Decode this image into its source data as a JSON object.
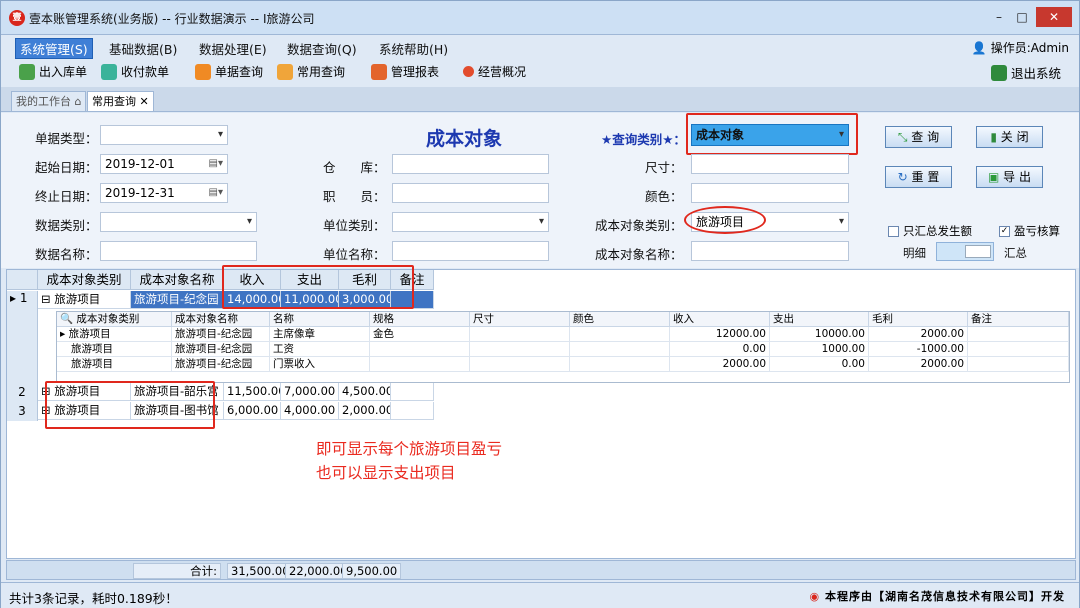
{
  "window": {
    "title": "壹本账管理系统(业务版) -- 行业数据演示 -- I旅游公司"
  },
  "menu": {
    "items": [
      "系统管理(S)",
      "基础数据(B)",
      "数据处理(E)",
      "数据查询(Q)",
      "系统帮助(H)"
    ],
    "operator": "操作员:Admin"
  },
  "toolbar": {
    "items": [
      "出入库单",
      "收付款单",
      "单据查询",
      "常用查询",
      "管理报表",
      "经营概况"
    ],
    "exit": "退出系统"
  },
  "tabs": [
    "我的工作台",
    "常用查询"
  ],
  "form": {
    "title": "成本对象",
    "doc_type_label": "单据类型：",
    "start_date_label": "起始日期：",
    "start_date": "2019-12-01",
    "end_date_label": "终止日期：",
    "end_date": "2019-12-31",
    "data_type_label": "数据类别：",
    "data_name_label": "数据名称：",
    "warehouse_label": "仓　　库：",
    "staff_label": "职　　员：",
    "unit_type_label": "单位类别：",
    "unit_name_label": "单位名称：",
    "query_type_label": "★查询类别★：",
    "query_type": "成本对象",
    "size_label": "尺寸：",
    "color_label": "颜色：",
    "cost_obj_type_label": "成本对象类别：",
    "cost_obj_type": "旅游项目",
    "cost_obj_name_label": "成本对象名称：",
    "btn_query": "查 询",
    "btn_close": "关 闭",
    "btn_reset": "重 置",
    "btn_export": "导 出",
    "chk_only_sum": "只汇总发生额",
    "chk_profit": "盈亏核算",
    "toggle_left": "明细",
    "toggle_right": "汇总"
  },
  "grid": {
    "headers": [
      "成本对象类别",
      "成本对象名称",
      "收入",
      "支出",
      "毛利",
      "备注"
    ],
    "rows": [
      {
        "num": "1",
        "type": "旅游项目",
        "name": "旅游项目-纪念园",
        "income": "14,000.00",
        "expense": "11,000.00",
        "profit": "3,000.00"
      },
      {
        "num": "2",
        "type": "旅游项目",
        "name": "旅游项目-韶乐宫",
        "income": "11,500.00",
        "expense": "7,000.00",
        "profit": "4,500.00"
      },
      {
        "num": "3",
        "type": "旅游项目",
        "name": "旅游项目-图书馆",
        "income": "6,000.00",
        "expense": "4,000.00",
        "profit": "2,000.00"
      }
    ],
    "sub_headers": [
      "成本对象类别",
      "成本对象名称",
      "名称",
      "规格",
      "尺寸",
      "颜色",
      "收入",
      "支出",
      "毛利",
      "备注"
    ],
    "sub_rows": [
      {
        "type": "旅游项目",
        "name": "旅游项目-纪念园",
        "item": "主席像章",
        "spec": "金色",
        "income": "12000.00",
        "expense": "10000.00",
        "profit": "2000.00"
      },
      {
        "type": "旅游项目",
        "name": "旅游项目-纪念园",
        "item": "工资",
        "spec": "",
        "income": "0.00",
        "expense": "1000.00",
        "profit": "-1000.00"
      },
      {
        "type": "旅游项目",
        "name": "旅游项目-纪念园",
        "item": "门票收入",
        "spec": "",
        "income": "2000.00",
        "expense": "0.00",
        "profit": "2000.00"
      }
    ],
    "total_label": "合计:",
    "total_income": "31,500.00",
    "total_expense": "22,000.00",
    "total_profit": "9,500.00"
  },
  "annotation": {
    "line1": "即可显示每个旅游项目盈亏",
    "line2": "也可以显示支出项目"
  },
  "status": {
    "text": "共计3条记录，耗时0.189秒！",
    "copyright": "本程序由【湖南名茂信息技术有限公司】开发"
  },
  "colors": {
    "accent": "#3f74c3",
    "highlight_red": "#e0281d",
    "title_blue": "#1d39b0"
  }
}
